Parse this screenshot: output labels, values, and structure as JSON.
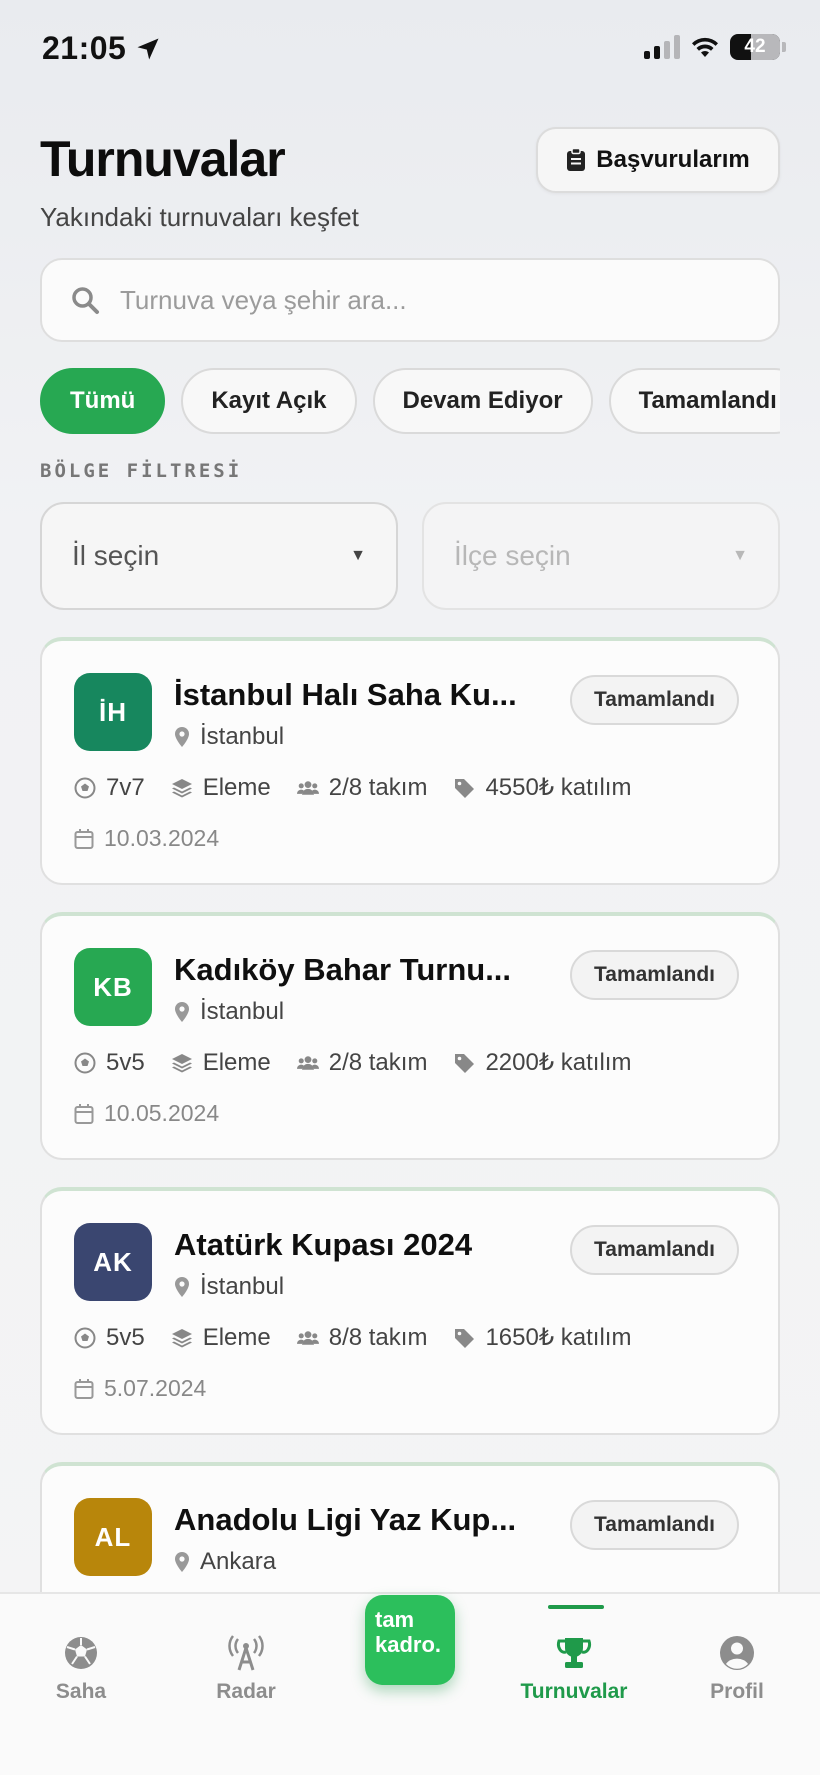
{
  "status_bar": {
    "time": "21:05",
    "battery": "42"
  },
  "header": {
    "title": "Turnuvalar",
    "subtitle": "Yakındaki turnuvaları keşfet",
    "applications_label": "Başvurularım"
  },
  "search": {
    "placeholder": "Turnuva veya şehir ara..."
  },
  "filters": {
    "chips": [
      "Tümü",
      "Kayıt Açık",
      "Devam Ediyor",
      "Tamamlandı"
    ],
    "active_chip": "Tümü",
    "region_label": "BÖLGE FİLTRESİ",
    "province_placeholder": "İl seçin",
    "district_placeholder": "İlçe seçin"
  },
  "tournaments": [
    {
      "initials": "İH",
      "avatar_color": "#17875e",
      "title": "İstanbul Halı Saha Ku...",
      "city": "İstanbul",
      "status": "Tamamlandı",
      "format": "7v7",
      "type": "Eleme",
      "teams": "2/8 takım",
      "fee": "4550₺ katılım",
      "date": "10.03.2024"
    },
    {
      "initials": "KB",
      "avatar_color": "#27a852",
      "title": "Kadıköy Bahar Turnu...",
      "city": "İstanbul",
      "status": "Tamamlandı",
      "format": "5v5",
      "type": "Eleme",
      "teams": "2/8 takım",
      "fee": "2200₺ katılım",
      "date": "10.05.2024"
    },
    {
      "initials": "AK",
      "avatar_color": "#3a4670",
      "title": "Atatürk Kupası 2024",
      "city": "İstanbul",
      "status": "Tamamlandı",
      "format": "5v5",
      "type": "Eleme",
      "teams": "8/8 takım",
      "fee": "1650₺ katılım",
      "date": "5.07.2024"
    },
    {
      "initials": "AL",
      "avatar_color": "#b8860b",
      "title": "Anadolu Ligi Yaz Kup...",
      "city": "Ankara",
      "status": "Tamamlandı"
    }
  ],
  "bottom_nav": {
    "items": [
      "Saha",
      "Radar",
      "Turnuvalar",
      "Profil"
    ],
    "active": "Turnuvalar",
    "logo_line1": "tam",
    "logo_line2": "kadro."
  },
  "colors": {
    "accent": "#27a852",
    "active_nav": "#1f9a4a"
  }
}
